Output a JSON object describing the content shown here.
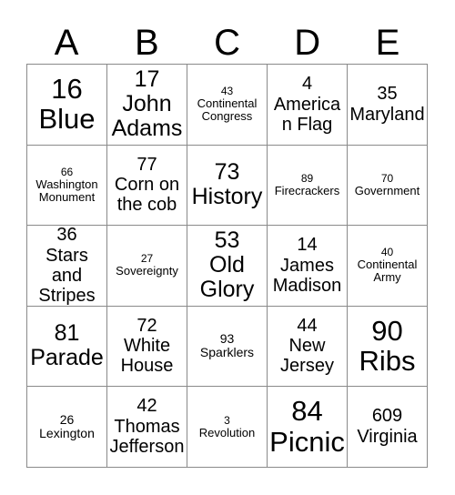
{
  "card": {
    "columns": [
      "A",
      "B",
      "C",
      "D",
      "E"
    ],
    "grid_line_color": "#8a8a8a",
    "text_color": "#000000",
    "background_color": "#ffffff",
    "rows": [
      [
        {
          "number": "16",
          "label": "Blue",
          "size": "xl"
        },
        {
          "number": "17",
          "label": "John Adams",
          "size": "lg"
        },
        {
          "number": "43",
          "label": "Continental Congress",
          "size": "xs"
        },
        {
          "number": "4",
          "label": "American Flag",
          "size": "md"
        },
        {
          "number": "35",
          "label": "Maryland",
          "size": "md"
        }
      ],
      [
        {
          "number": "66",
          "label": "Washington Monument",
          "size": "xs"
        },
        {
          "number": "77",
          "label": "Corn on the cob",
          "size": "md"
        },
        {
          "number": "73",
          "label": "History",
          "size": "lg"
        },
        {
          "number": "89",
          "label": "Firecrackers",
          "size": "xs"
        },
        {
          "number": "70",
          "label": "Government",
          "size": "xs"
        }
      ],
      [
        {
          "number": "36",
          "label": "Stars and Stripes",
          "size": "md"
        },
        {
          "number": "27",
          "label": "Sovereignty",
          "size": "xs"
        },
        {
          "number": "53",
          "label": "Old Glory",
          "size": "lg"
        },
        {
          "number": "14",
          "label": "James Madison",
          "size": "md"
        },
        {
          "number": "40",
          "label": "Continental Army",
          "size": "xs"
        }
      ],
      [
        {
          "number": "81",
          "label": "Parade",
          "size": "lg"
        },
        {
          "number": "72",
          "label": "White House",
          "size": "md"
        },
        {
          "number": "93",
          "label": "Sparklers",
          "size": "sm"
        },
        {
          "number": "44",
          "label": "New Jersey",
          "size": "md"
        },
        {
          "number": "90",
          "label": "Ribs",
          "size": "xl"
        }
      ],
      [
        {
          "number": "26",
          "label": "Lexington",
          "size": "sm"
        },
        {
          "number": "42",
          "label": "Thomas Jefferson",
          "size": "md"
        },
        {
          "number": "3",
          "label": "Revolution",
          "size": "xs"
        },
        {
          "number": "84",
          "label": "Picnic",
          "size": "xl"
        },
        {
          "number": "609",
          "label": "Virginia",
          "size": "md"
        }
      ]
    ]
  }
}
